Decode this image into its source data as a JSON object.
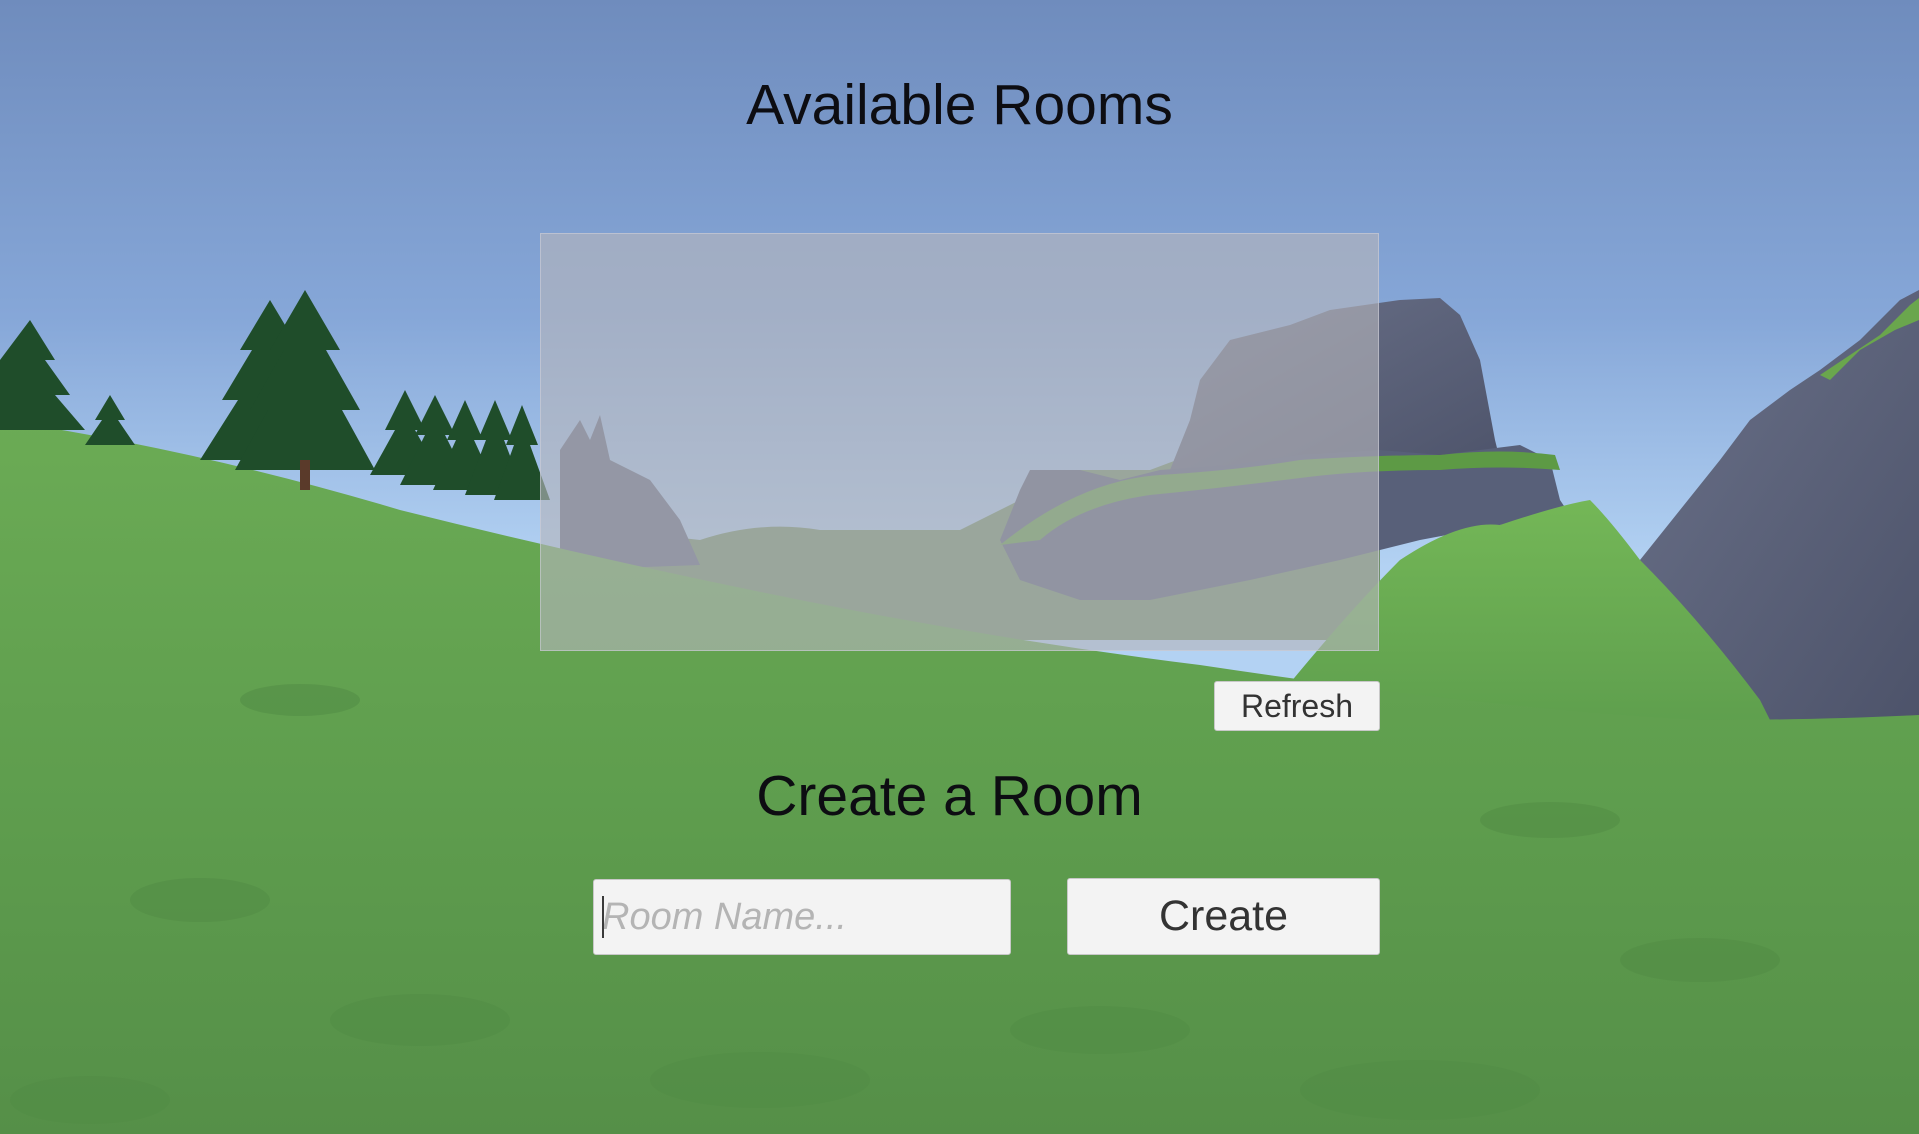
{
  "lobby": {
    "available_rooms_title": "Available Rooms",
    "rooms": [],
    "refresh_label": "Refresh",
    "create_room_title": "Create a Room",
    "room_name_input": {
      "value": "",
      "placeholder": "Room Name..."
    },
    "create_label": "Create"
  },
  "colors": {
    "sky_top": "#6f8cbd",
    "sky_horizon": "#b3d2f3",
    "grass": "#5e9e4f",
    "rock": "#555c72",
    "panel_overlay": "#b4b4bc",
    "button_background": "#f3f3f3",
    "button_text": "#333333",
    "title_text": "#0d0d12",
    "placeholder_text": "#b4b4b4"
  }
}
